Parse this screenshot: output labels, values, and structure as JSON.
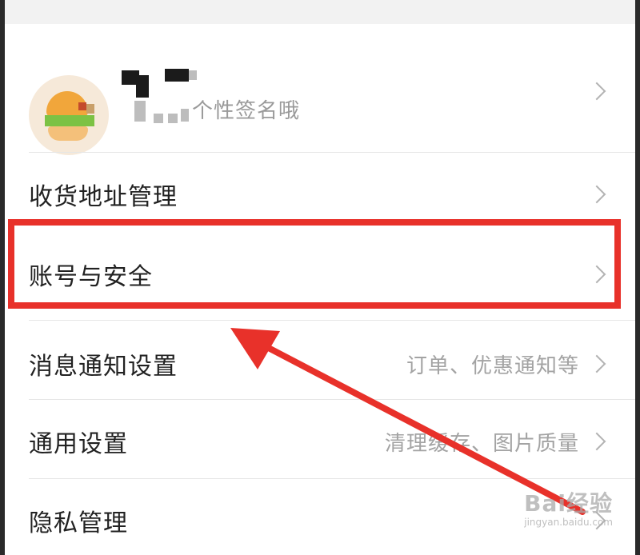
{
  "profile": {
    "signature": "个性签名哦"
  },
  "menu": {
    "items": [
      {
        "label": "收货地址管理",
        "hint": ""
      },
      {
        "label": "账号与安全",
        "hint": ""
      },
      {
        "label": "消息通知设置",
        "hint": "订单、优惠通知等"
      },
      {
        "label": "通用设置",
        "hint": "清理缓存、图片质量"
      },
      {
        "label": "隐私管理",
        "hint": ""
      }
    ]
  },
  "annotation": {
    "highlight_color": "#e8312a"
  },
  "watermark": {
    "main": "Bai经验",
    "sub": "jingyan.baidu.com"
  },
  "icons": {
    "chevron": "chevron-right-icon",
    "avatar": "burger-avatar"
  }
}
